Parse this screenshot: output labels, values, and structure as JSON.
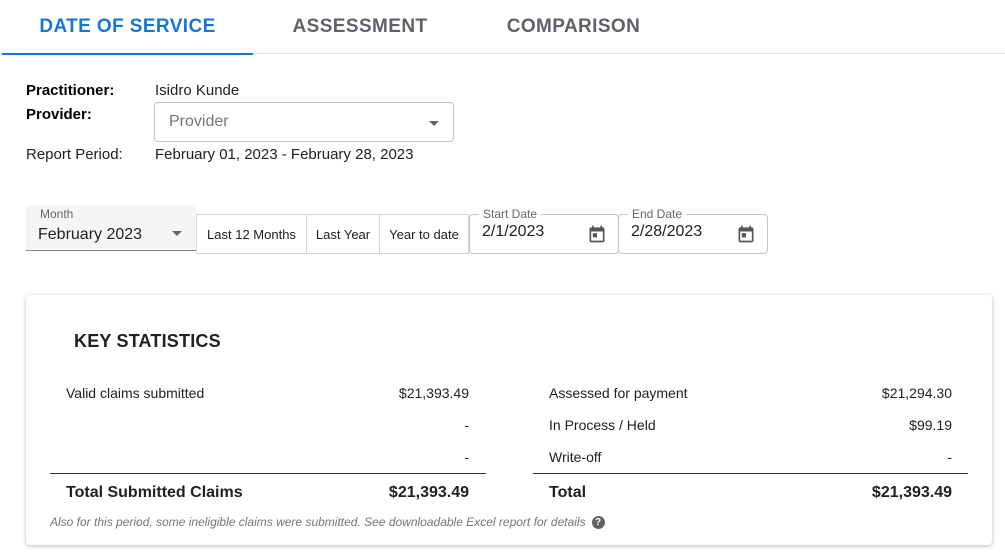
{
  "tabs": [
    {
      "label": "DATE OF SERVICE",
      "active": true
    },
    {
      "label": "ASSESSMENT",
      "active": false
    },
    {
      "label": "COMPARISON",
      "active": false
    }
  ],
  "info": {
    "practitioner_label": "Practitioner:",
    "practitioner_value": "Isidro Kunde",
    "provider_label": "Provider:",
    "provider_placeholder": "Provider",
    "period_label": "Report Period:",
    "period_value": "February 01, 2023 - February 28, 2023"
  },
  "filters": {
    "month_label": "Month",
    "month_value": "February 2023",
    "btn_last12": "Last 12 Months",
    "btn_last_year": "Last Year",
    "btn_ytd": "Year to date",
    "start_label": "Start Date",
    "start_value": "2/1/2023",
    "end_label": "End Date",
    "end_value": "2/28/2023"
  },
  "stats": {
    "title": "KEY STATISTICS",
    "left": {
      "rows": [
        {
          "label": "Valid claims submitted",
          "value": "$21,393.49"
        },
        {
          "label": "",
          "value": "-"
        },
        {
          "label": "",
          "value": "-"
        }
      ],
      "total_label": "Total Submitted Claims",
      "total_value": "$21,393.49"
    },
    "right": {
      "rows": [
        {
          "label": "Assessed for payment",
          "value": "$21,294.30"
        },
        {
          "label": "In Process / Held",
          "value": "$99.19"
        },
        {
          "label": "Write-off",
          "value": "-"
        }
      ],
      "total_label": "Total",
      "total_value": "$21,393.49"
    },
    "note": "Also for this period, some ineligible claims were submitted. See downloadable Excel report for details",
    "help_glyph": "?"
  },
  "colors": {
    "accent": "#1976d2",
    "tab_inactive": "#5f6368"
  }
}
